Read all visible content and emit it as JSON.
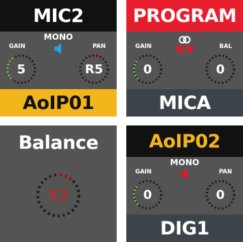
{
  "colors": {
    "tile_bg": "#545454",
    "dark_bar": "#111111",
    "red_bar": "#e81d2c",
    "yellow_bar": "#f2b51c",
    "slate_bar": "#3d434b",
    "gain_green": "#7ec03a",
    "pan_red": "#e01a24",
    "mono_blue": "#1ea7e0",
    "orange_text": "#f2b51c"
  },
  "tiles": [
    {
      "title": "MIC2",
      "mode": "MONO",
      "gain_label": "GAIN",
      "gain_value": "5",
      "pan_label": "PAN",
      "pan_value": "R5",
      "footer": "AoIP01",
      "icon": "mono-speaker-icon"
    },
    {
      "title": "PROGRAM",
      "mode_icon": "stereo-link-icon",
      "gain_label": "GAIN",
      "gain_value": "0",
      "bal_label": "BAL",
      "bal_value": "0",
      "footer": "MICA",
      "icon": "stereo-speaker-icon"
    },
    {
      "title": "Balance",
      "value": "R3"
    },
    {
      "title": "AoIP02",
      "mode": "MONO",
      "gain_label": "GAIN",
      "gain_value": "0",
      "pan_label": "PAN",
      "pan_value": "0",
      "footer": "DIG1",
      "icon": "mono-speaker-icon"
    }
  ]
}
